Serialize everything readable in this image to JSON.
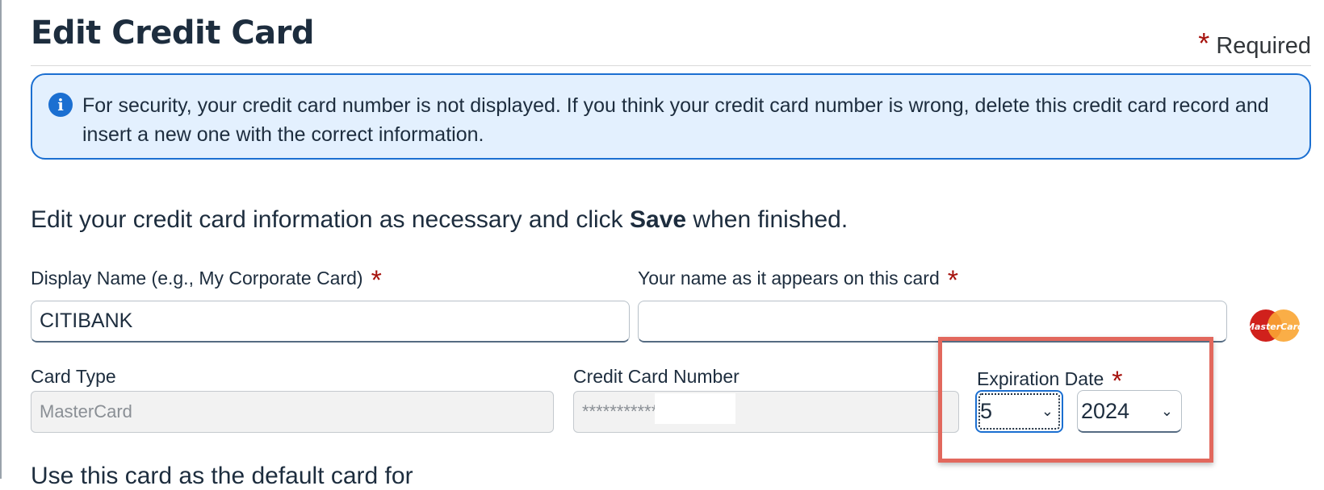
{
  "page": {
    "title": "Edit Credit Card",
    "required_star": "*",
    "required_label": "Required"
  },
  "info": {
    "icon": "info-icon",
    "glyph": "i",
    "message": "For security, your credit card number is not displayed. If you think your credit card number is wrong, delete this credit card record and insert a new one with the correct information."
  },
  "instructions": {
    "prefix": "Edit your credit card information as necessary and click ",
    "bold": "Save",
    "suffix": " when finished."
  },
  "form": {
    "display_name": {
      "label": "Display Name (e.g., My Corporate Card)",
      "required": "*",
      "value": "CITIBANK"
    },
    "card_holder": {
      "label": "Your name as it appears on this card",
      "required": "*",
      "value": ""
    },
    "card_type": {
      "label": "Card Type",
      "value": "MasterCard"
    },
    "card_number": {
      "label": "Credit Card Number",
      "value": "***********"
    },
    "expiration": {
      "label": "Expiration Date",
      "required": "*",
      "month": "5",
      "year": "2024"
    },
    "card_logo": {
      "icon": "mastercard-logo-icon",
      "text": "MasterCard",
      "colors": [
        "#d0211c",
        "#f9a533"
      ]
    }
  },
  "partial_text": "Use this card as the default card for",
  "colors": {
    "accent": "#1b6fd1",
    "required": "#a6120d",
    "highlight": "#e2685d",
    "info_bg": "#e3f0fe"
  }
}
